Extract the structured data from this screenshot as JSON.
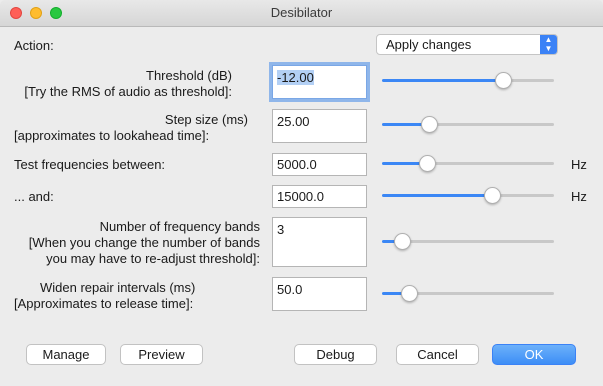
{
  "window": {
    "title": "Desibilator"
  },
  "action": {
    "label": "Action:",
    "selected": "Apply changes"
  },
  "params": {
    "threshold": {
      "label1": "Threshold (dB)",
      "label2": "[Try the RMS of audio as threshold]:",
      "value": "-12.00",
      "slider_fraction": 0.73
    },
    "step": {
      "label1": "Step size (ms)",
      "label2": "[approximates to lookahead time]:",
      "value": "25.00",
      "slider_fraction": 0.25
    },
    "freq_low": {
      "label": "Test frequencies between:",
      "value": "5000.0",
      "unit": "Hz",
      "slider_fraction": 0.24
    },
    "freq_high": {
      "label": "... and:",
      "value": "15000.0",
      "unit": "Hz",
      "slider_fraction": 0.66
    },
    "bands": {
      "label1": "Number of frequency bands",
      "label2": "[When you change the number of bands",
      "label3": "you may have to re-adjust threshold]:",
      "value": "3",
      "slider_fraction": 0.08
    },
    "widen": {
      "label1": "Widen repair intervals (ms)",
      "label2": "[Approximates to release time]:",
      "value": "50.0",
      "slider_fraction": 0.12
    }
  },
  "buttons": {
    "manage": "Manage",
    "preview": "Preview",
    "debug": "Debug",
    "cancel": "Cancel",
    "ok": "OK"
  },
  "colors": {
    "accent": "#3b87f5"
  }
}
